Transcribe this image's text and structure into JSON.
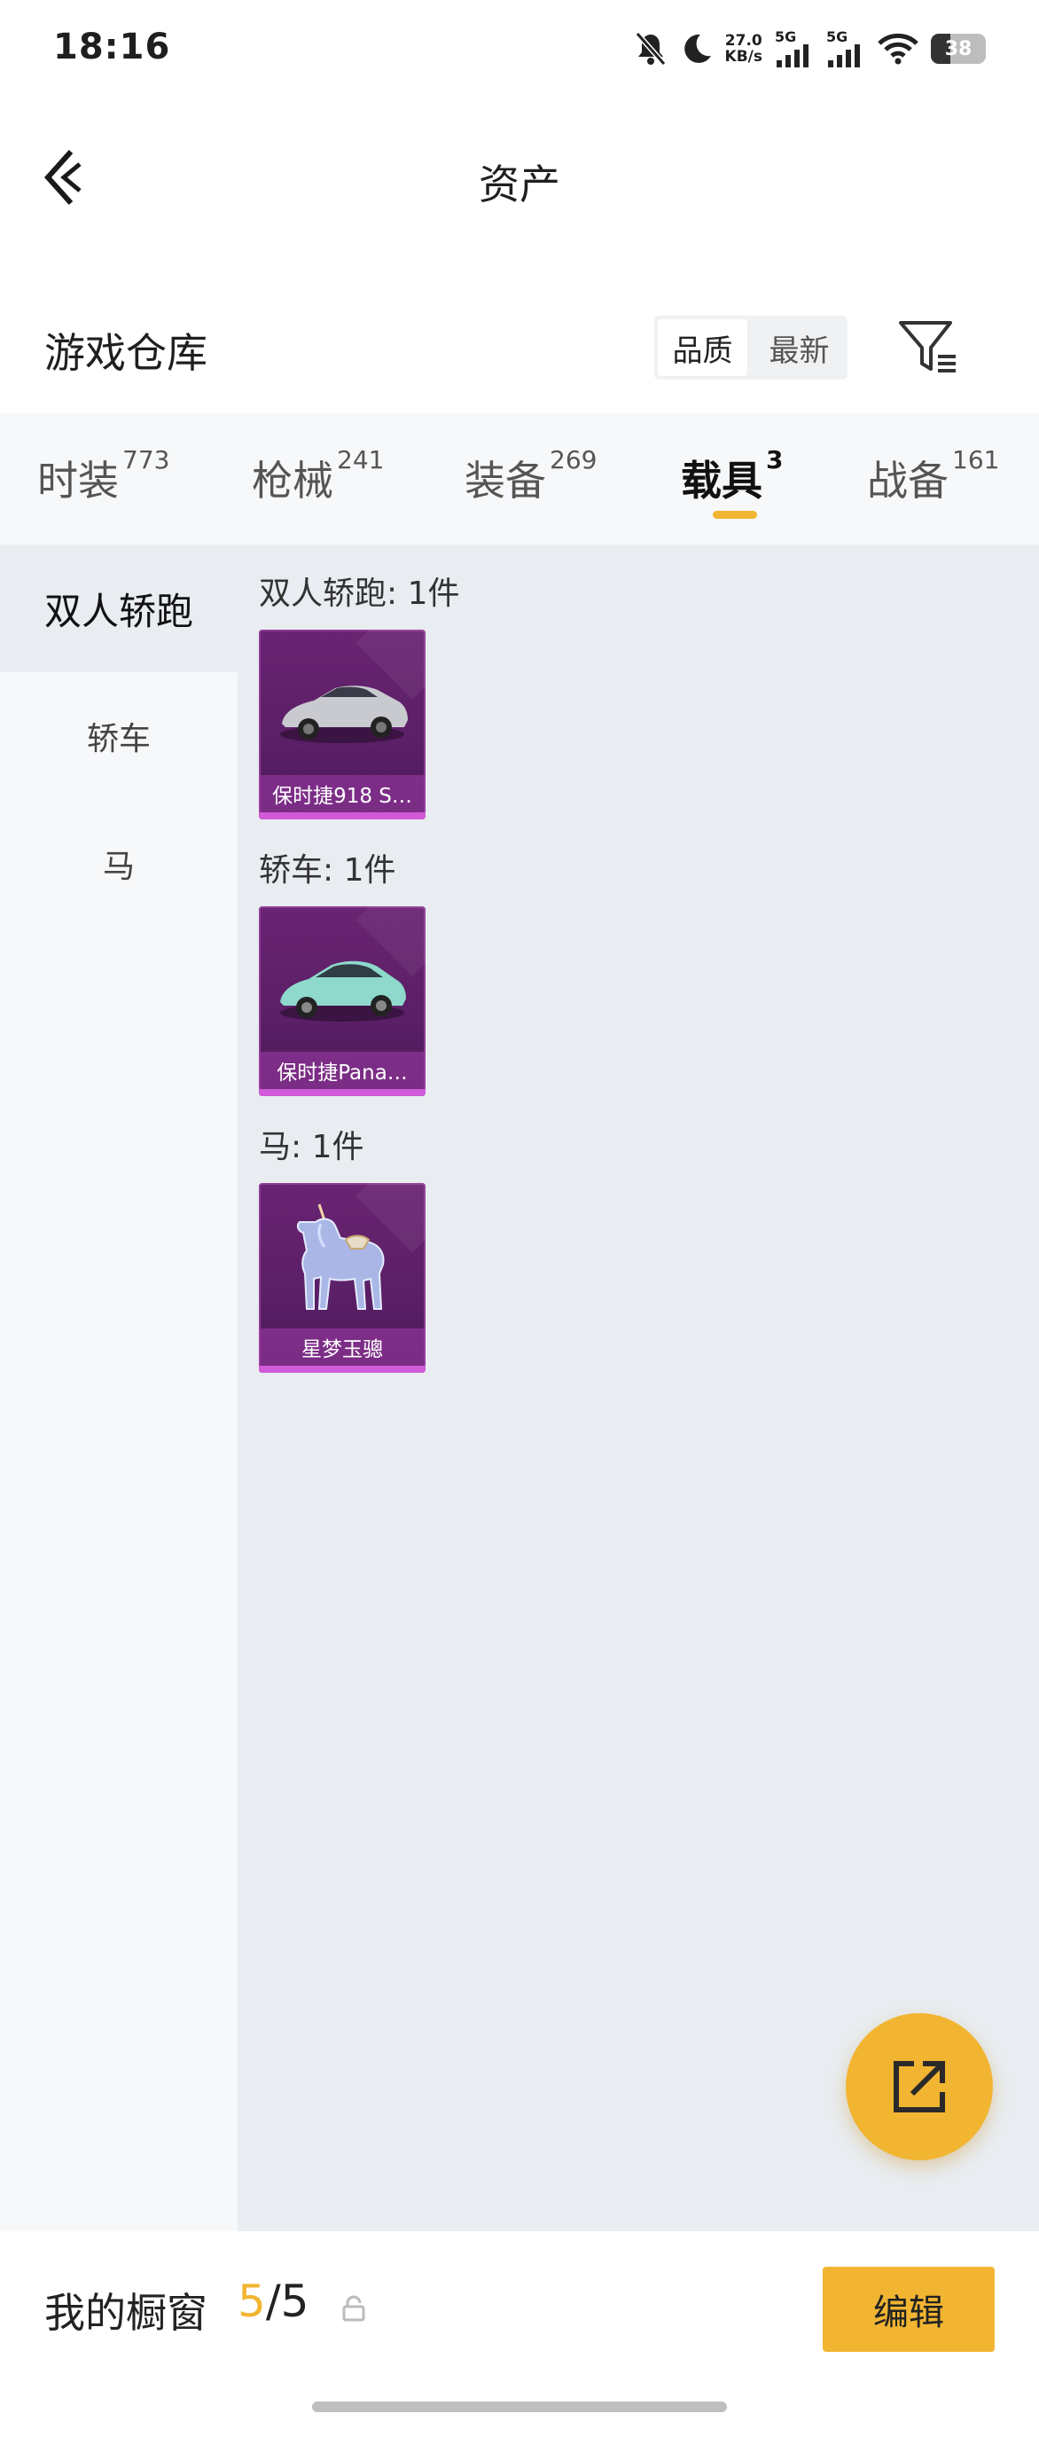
{
  "status_bar": {
    "time": "18:16",
    "net_speed_value": "27.0",
    "net_speed_unit": "KB/s",
    "signal_1": "5G",
    "signal_2": "5G",
    "battery": "38"
  },
  "header": {
    "title": "资产"
  },
  "section": {
    "title": "游戏仓库",
    "sort_options": [
      "品质",
      "最新"
    ],
    "selected_sort": "品质"
  },
  "tabs": [
    {
      "label": "时装",
      "count": "773"
    },
    {
      "label": "枪械",
      "count": "241"
    },
    {
      "label": "装备",
      "count": "269"
    },
    {
      "label": "载具",
      "count": "3"
    },
    {
      "label": "战备",
      "count": "161"
    }
  ],
  "active_tab": "载具",
  "sidebar": {
    "items": [
      "双人轿跑",
      "轿车",
      "马"
    ],
    "active": "双人轿跑"
  },
  "groups": [
    {
      "label": "双人轿跑: 1件",
      "item_name": "保时捷918 S…",
      "icon": "silver-sports-car"
    },
    {
      "label": "轿车: 1件",
      "item_name": "保时捷Pana…",
      "icon": "mint-sedan-car"
    },
    {
      "label": "马: 1件",
      "item_name": "星梦玉骢",
      "icon": "crystal-unicorn-horse"
    }
  ],
  "bottom_bar": {
    "label": "我的橱窗",
    "current": "5",
    "separator": "/",
    "total": "5",
    "edit_label": "编辑"
  },
  "colors": {
    "accent": "#f2b531",
    "card_bg": "#5a1f66",
    "content_bg": "#e9edf1"
  }
}
